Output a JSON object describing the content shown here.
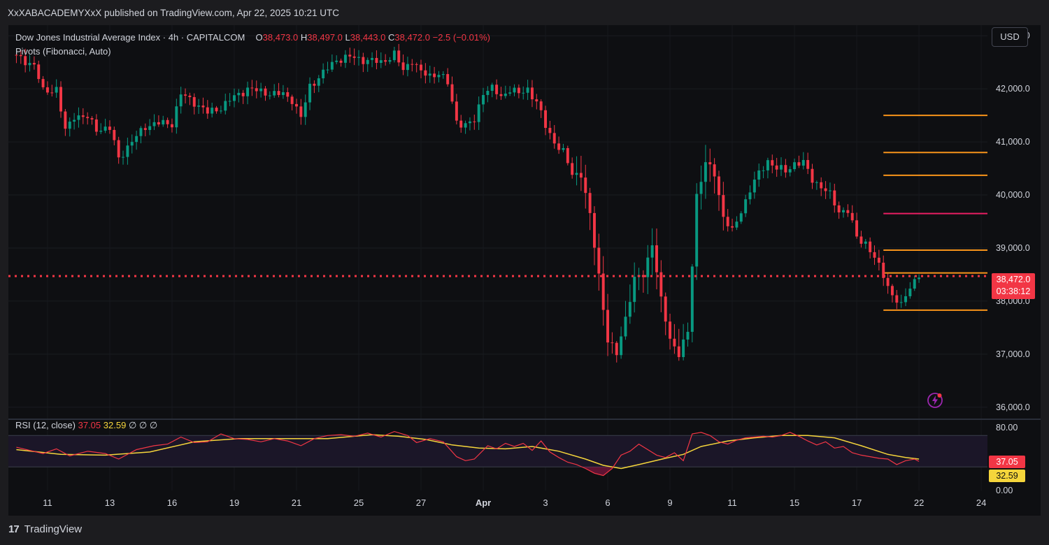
{
  "header": {
    "published": "XxXABACADEMYXxX published on TradingView.com, Apr 22, 2025 10:21 UTC"
  },
  "legend": {
    "symbol": "Dow Jones Industrial Average Index · 4h · CAPITALCOM",
    "open_label": "O",
    "open": "38,473.0",
    "high_label": "H",
    "high": "38,497.0",
    "low_label": "L",
    "low": "38,443.0",
    "close_label": "C",
    "close": "38,472.0",
    "change": "−2.5 (−0.01%)",
    "indicator": "Pivots (Fibonacci, Auto)"
  },
  "rsi_legend": {
    "name": "RSI (12, close)",
    "rsi": "37.05",
    "ma": "32.59",
    "extra": "∅  ∅  ∅"
  },
  "currency_button": "USD",
  "price_tag": {
    "price": "38,472.0",
    "countdown": "03:38:12"
  },
  "rsi_tags": {
    "rsi": "37.05",
    "ma": "32.59"
  },
  "footer": {
    "logo_mark": "17",
    "brand": "TradingView"
  },
  "colors": {
    "up": "#089981",
    "down": "#f23645",
    "pivot_orange": "#f7931a",
    "pivot_pink": "#e91e63",
    "rsi": "#f23645",
    "rsi_ma": "#f5d53b"
  },
  "icons": {
    "bolt": "lightning-bolt-icon"
  },
  "chart_data": [
    {
      "type": "candlestick",
      "title": "Dow Jones Industrial Average Index · 4h · CAPITALCOM",
      "ylim": [
        35800,
        43200
      ],
      "y_ticks": [
        {
          "value": 36000,
          "label": "36,000.0"
        },
        {
          "value": 37000,
          "label": "37,000.0"
        },
        {
          "value": 38000,
          "label": "38,000.0"
        },
        {
          "value": 39000,
          "label": "39,000.0"
        },
        {
          "value": 40000,
          "label": "40,000.0"
        },
        {
          "value": 41000,
          "label": "41,000.0"
        },
        {
          "value": 42000,
          "label": "42,000.0"
        },
        {
          "value": 43000,
          "label": "43,000.0"
        }
      ],
      "x_ticks": [
        {
          "index": 7,
          "label": "11"
        },
        {
          "index": 21,
          "label": "13"
        },
        {
          "index": 35,
          "label": "16"
        },
        {
          "index": 49,
          "label": "19"
        },
        {
          "index": 63,
          "label": "21"
        },
        {
          "index": 77,
          "label": "25"
        },
        {
          "index": 91,
          "label": "27"
        },
        {
          "index": 105,
          "label": "Apr"
        },
        {
          "index": 119,
          "label": "3"
        },
        {
          "index": 133,
          "label": "6"
        },
        {
          "index": 147,
          "label": "9"
        },
        {
          "index": 161,
          "label": "11"
        },
        {
          "index": 175,
          "label": "15"
        },
        {
          "index": 189,
          "label": "17"
        },
        {
          "index": 203,
          "label": "22"
        },
        {
          "index": 217,
          "label": "24"
        }
      ],
      "x_range": [
        -1.8,
        218.4
      ],
      "last_price": 38472,
      "pivots": [
        {
          "value": 41500,
          "color": "#f7931a",
          "start_index": 195
        },
        {
          "value": 40800,
          "color": "#f7931a",
          "start_index": 195
        },
        {
          "value": 40370,
          "color": "#f7931a",
          "start_index": 195
        },
        {
          "value": 39650,
          "color": "#e91e63",
          "start_index": 195
        },
        {
          "value": 38960,
          "color": "#f7931a",
          "start_index": 195
        },
        {
          "value": 38530,
          "color": "#f7931a",
          "start_index": 195
        },
        {
          "value": 37830,
          "color": "#f7931a",
          "start_index": 195
        }
      ],
      "close_path": [
        [
          0,
          42600
        ],
        [
          4,
          42450
        ],
        [
          6,
          41950
        ],
        [
          9,
          42000
        ],
        [
          11,
          41200
        ],
        [
          13,
          41500
        ],
        [
          16,
          41450
        ],
        [
          18,
          41250
        ],
        [
          21,
          41250
        ],
        [
          23,
          40700
        ],
        [
          26,
          41000
        ],
        [
          29,
          41300
        ],
        [
          32,
          41350
        ],
        [
          35,
          41350
        ],
        [
          37,
          41900
        ],
        [
          40,
          41750
        ],
        [
          43,
          41550
        ],
        [
          46,
          41650
        ],
        [
          49,
          41850
        ],
        [
          52,
          42000
        ],
        [
          55,
          41950
        ],
        [
          58,
          41900
        ],
        [
          60,
          41900
        ],
        [
          62,
          41800
        ],
        [
          64,
          41450
        ],
        [
          66,
          42050
        ],
        [
          69,
          42300
        ],
        [
          72,
          42550
        ],
        [
          75,
          42600
        ],
        [
          78,
          42550
        ],
        [
          82,
          42500
        ],
        [
          85,
          42650
        ],
        [
          87,
          42350
        ],
        [
          89,
          42550
        ],
        [
          91,
          42300
        ],
        [
          93,
          42250
        ],
        [
          95,
          42300
        ],
        [
          97,
          42100
        ],
        [
          99,
          41400
        ],
        [
          101,
          41300
        ],
        [
          103,
          41400
        ],
        [
          105,
          41950
        ],
        [
          107,
          42000
        ],
        [
          109,
          41850
        ],
        [
          111,
          42000
        ],
        [
          113,
          41900
        ],
        [
          115,
          42000
        ],
        [
          117,
          41750
        ],
        [
          119,
          41300
        ],
        [
          121,
          41000
        ],
        [
          123,
          40800
        ],
        [
          125,
          40400
        ],
        [
          127,
          40400
        ],
        [
          129,
          39600
        ],
        [
          131,
          38500
        ],
        [
          133,
          37250
        ],
        [
          135,
          37000
        ],
        [
          137,
          37700
        ],
        [
          139,
          38400
        ],
        [
          141,
          38500
        ],
        [
          143,
          39100
        ],
        [
          145,
          38000
        ],
        [
          147,
          37300
        ],
        [
          149,
          37000
        ],
        [
          151,
          37400
        ],
        [
          153,
          40000
        ],
        [
          155,
          40600
        ],
        [
          157,
          40400
        ],
        [
          159,
          39600
        ],
        [
          161,
          39300
        ],
        [
          163,
          39700
        ],
        [
          165,
          40100
        ],
        [
          167,
          40400
        ],
        [
          169,
          40650
        ],
        [
          171,
          40500
        ],
        [
          173,
          40450
        ],
        [
          175,
          40600
        ],
        [
          177,
          40600
        ],
        [
          179,
          40300
        ],
        [
          181,
          40150
        ],
        [
          183,
          40000
        ],
        [
          185,
          39700
        ],
        [
          187,
          39700
        ],
        [
          189,
          39200
        ],
        [
          191,
          39100
        ],
        [
          193,
          38800
        ],
        [
          195,
          38500
        ],
        [
          197,
          38100
        ],
        [
          199,
          37900
        ],
        [
          201,
          38300
        ],
        [
          203,
          38472
        ]
      ]
    },
    {
      "type": "line",
      "title": "RSI (12, close)",
      "ylim": [
        0,
        88
      ],
      "y_ticks": [
        {
          "value": 0,
          "label": "0.00"
        },
        {
          "value": 80,
          "label": "80.00"
        }
      ],
      "bands": [
        30,
        70
      ],
      "rsi_path": [
        [
          0,
          55
        ],
        [
          6,
          47
        ],
        [
          9,
          53
        ],
        [
          12,
          44
        ],
        [
          16,
          50
        ],
        [
          20,
          47
        ],
        [
          23,
          40
        ],
        [
          27,
          52
        ],
        [
          31,
          57
        ],
        [
          34,
          59
        ],
        [
          37,
          68
        ],
        [
          40,
          61
        ],
        [
          43,
          62
        ],
        [
          46,
          72
        ],
        [
          49,
          66
        ],
        [
          52,
          65
        ],
        [
          55,
          62
        ],
        [
          58,
          66
        ],
        [
          61,
          63
        ],
        [
          64,
          57
        ],
        [
          67,
          66
        ],
        [
          70,
          70
        ],
        [
          73,
          71
        ],
        [
          76,
          69
        ],
        [
          79,
          73
        ],
        [
          82,
          68
        ],
        [
          85,
          75
        ],
        [
          88,
          70
        ],
        [
          90,
          61
        ],
        [
          93,
          66
        ],
        [
          96,
          62
        ],
        [
          99,
          43
        ],
        [
          101,
          38
        ],
        [
          103,
          40
        ],
        [
          106,
          57
        ],
        [
          108,
          53
        ],
        [
          110,
          60
        ],
        [
          112,
          56
        ],
        [
          114,
          60
        ],
        [
          116,
          51
        ],
        [
          118,
          63
        ],
        [
          120,
          49
        ],
        [
          122,
          42
        ],
        [
          124,
          36
        ],
        [
          126,
          33
        ],
        [
          128,
          28
        ],
        [
          130,
          22
        ],
        [
          132,
          19
        ],
        [
          134,
          28
        ],
        [
          136,
          45
        ],
        [
          138,
          50
        ],
        [
          140,
          59
        ],
        [
          142,
          52
        ],
        [
          144,
          45
        ],
        [
          146,
          42
        ],
        [
          148,
          48
        ],
        [
          150,
          38
        ],
        [
          152,
          72
        ],
        [
          154,
          74
        ],
        [
          156,
          70
        ],
        [
          158,
          62
        ],
        [
          160,
          59
        ],
        [
          162,
          64
        ],
        [
          164,
          67
        ],
        [
          166,
          68
        ],
        [
          168,
          69
        ],
        [
          170,
          68
        ],
        [
          172,
          70
        ],
        [
          174,
          74
        ],
        [
          176,
          69
        ],
        [
          178,
          63
        ],
        [
          180,
          58
        ],
        [
          182,
          62
        ],
        [
          184,
          54
        ],
        [
          186,
          56
        ],
        [
          188,
          48
        ],
        [
          190,
          45
        ],
        [
          192,
          43
        ],
        [
          194,
          41
        ],
        [
          196,
          40
        ],
        [
          198,
          33
        ],
        [
          200,
          38
        ],
        [
          202,
          40
        ],
        [
          203,
          37
        ]
      ],
      "ma_path": [
        [
          0,
          52
        ],
        [
          10,
          46
        ],
        [
          20,
          45
        ],
        [
          30,
          49
        ],
        [
          40,
          62
        ],
        [
          50,
          66
        ],
        [
          60,
          66
        ],
        [
          70,
          66
        ],
        [
          80,
          71
        ],
        [
          86,
          69
        ],
        [
          92,
          65
        ],
        [
          98,
          58
        ],
        [
          104,
          54
        ],
        [
          110,
          53
        ],
        [
          116,
          56
        ],
        [
          122,
          50
        ],
        [
          128,
          40
        ],
        [
          132,
          32
        ],
        [
          136,
          28
        ],
        [
          140,
          33
        ],
        [
          146,
          41
        ],
        [
          150,
          46
        ],
        [
          154,
          56
        ],
        [
          160,
          63
        ],
        [
          166,
          67
        ],
        [
          172,
          70
        ],
        [
          178,
          70
        ],
        [
          184,
          67
        ],
        [
          190,
          57
        ],
        [
          196,
          46
        ],
        [
          200,
          42
        ],
        [
          203,
          40
        ]
      ]
    }
  ]
}
